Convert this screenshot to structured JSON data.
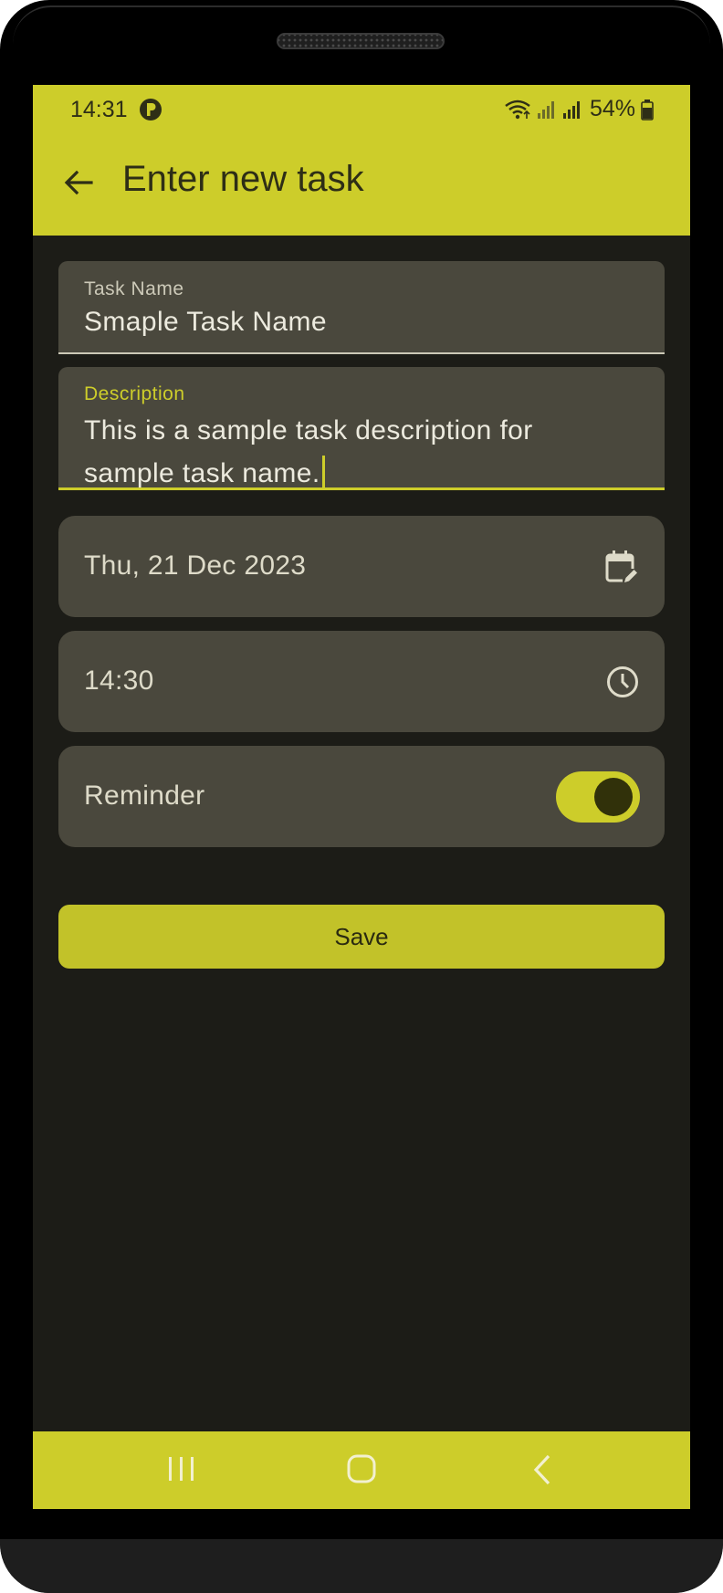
{
  "status_bar": {
    "time": "14:31",
    "battery": "54%"
  },
  "app_bar": {
    "title": "Enter new task",
    "back_icon": "arrow-back-icon"
  },
  "form": {
    "task_name": {
      "label": "Task Name",
      "value": "Smaple Task Name"
    },
    "description": {
      "label": "Description",
      "value_line1": "This is a sample task description for",
      "value_line2": "sample task name."
    },
    "date": {
      "value": "Thu, 21 Dec 2023",
      "icon": "calendar-edit-icon"
    },
    "time": {
      "value": "14:30",
      "icon": "clock-icon"
    },
    "reminder": {
      "label": "Reminder",
      "enabled": true
    },
    "save_label": "Save"
  },
  "nav_bar": {
    "recents_icon": "recents-icon",
    "home_icon": "home-icon",
    "back_icon": "back-chevron-icon"
  },
  "colors": {
    "accent": "#cdcd2a",
    "background": "#1c1c17",
    "surface": "#4a483d"
  }
}
